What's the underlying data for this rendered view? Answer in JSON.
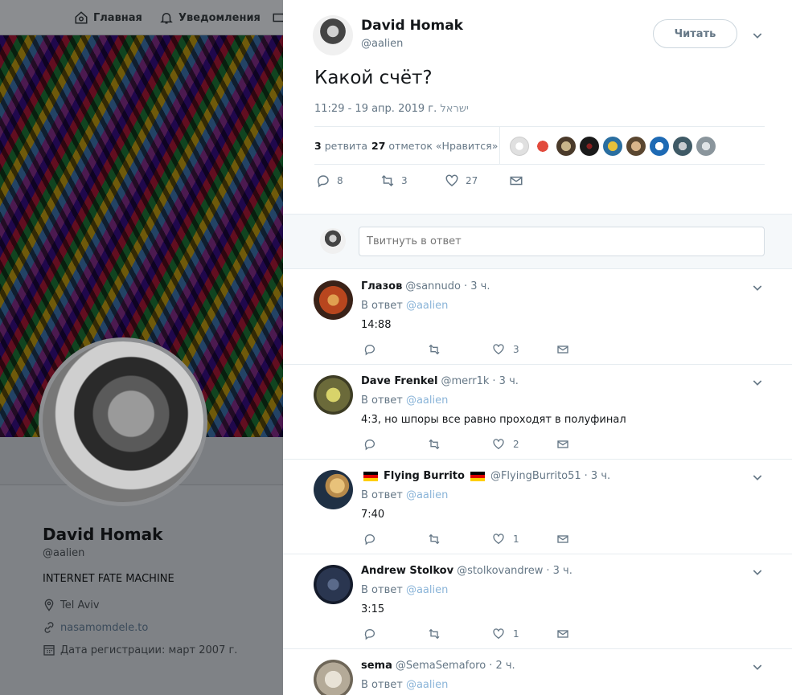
{
  "nav": {
    "home": "Главная",
    "notifications": "Уведомления"
  },
  "profile": {
    "name": "David Homak",
    "handle": "@aalien",
    "bio": "INTERNET FATE MACHINE",
    "location": "Tel Aviv",
    "link": "nasamomdele.to",
    "joined": "Дата регистрации: март 2007 г."
  },
  "tweet": {
    "author_name": "David Homak",
    "author_handle": "@aalien",
    "follow_label": "Читать",
    "text": "Какой счёт?",
    "time": "11:29 - 19 апр. 2019 г.",
    "location": "ישראל",
    "retweets_count": "3",
    "retweets_label": "ретвита",
    "likes_count": "27",
    "likes_label": "отметок «Нравится»",
    "replies": "8",
    "retweets": "3",
    "likes": "27"
  },
  "reply_box": {
    "placeholder": "Твитнуть в ответ"
  },
  "replies": [
    {
      "name": "Глазов",
      "handle": "@sannudo",
      "time": "· 3 ч.",
      "in_reply": "В ответ",
      "to": "@aalien",
      "text": "14:88",
      "likes": "3"
    },
    {
      "name": "Dave Frenkel",
      "handle": "@merr1k",
      "time": "· 3 ч.",
      "in_reply": "В ответ",
      "to": "@aalien",
      "text": "4:3, но шпоры все равно проходят в полуфинал",
      "likes": "2"
    },
    {
      "name": "Flying Burrito",
      "handle": "@FlyingBurrito51",
      "time": "· 3 ч.",
      "in_reply": "В ответ",
      "to": "@aalien",
      "text": "7:40",
      "likes": "1"
    },
    {
      "name": "Andrew Stolkov",
      "handle": "@stolkovandrew",
      "time": "· 3 ч.",
      "in_reply": "В ответ",
      "to": "@aalien",
      "text": "3:15",
      "likes": "1"
    },
    {
      "name": "sema",
      "handle": "@SemaSemaforo",
      "time": "· 2 ч.",
      "in_reply": "В ответ",
      "to": "@aalien",
      "text": "",
      "likes": ""
    }
  ],
  "colors": {
    "accent": "#1da1f2",
    "muted": "#657786",
    "border": "#e6ecf0"
  }
}
